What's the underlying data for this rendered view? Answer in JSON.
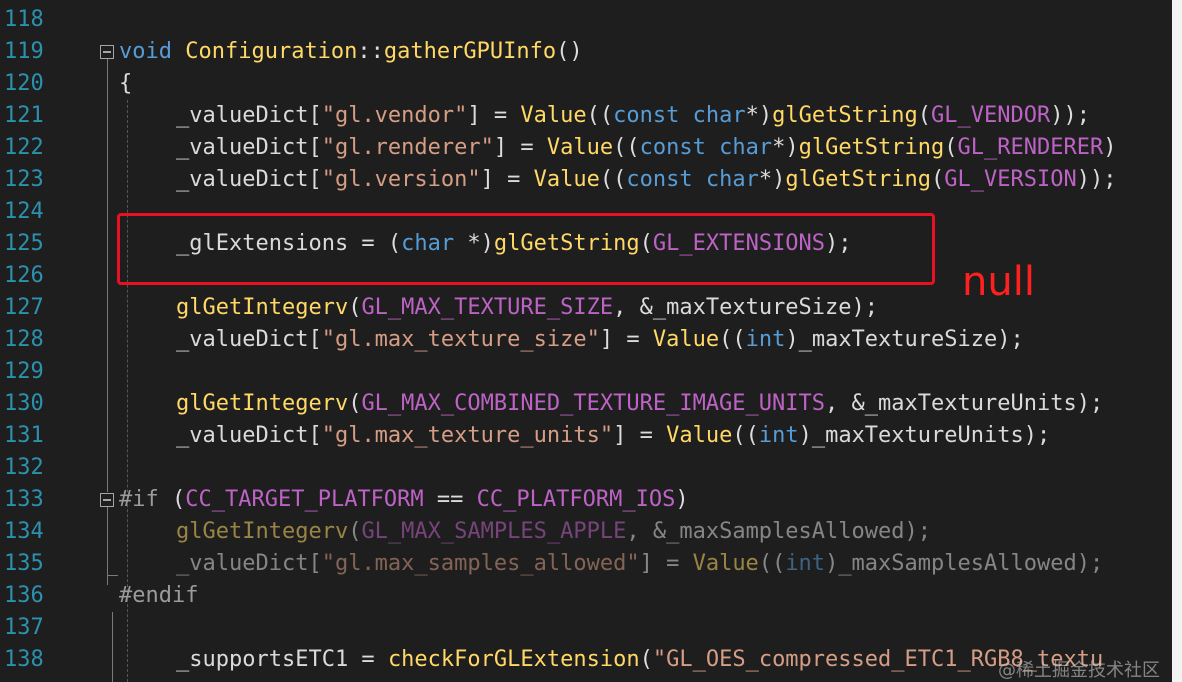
{
  "editor": {
    "lines": [
      {
        "n": "118",
        "code": ""
      },
      {
        "n": "119",
        "code": "void Configuration::gatherGPUInfo()"
      },
      {
        "n": "120",
        "code": "{"
      },
      {
        "n": "121",
        "code": "_valueDict[\"gl.vendor\"] = Value((const char*)glGetString(GL_VENDOR));"
      },
      {
        "n": "122",
        "code": "_valueDict[\"gl.renderer\"] = Value((const char*)glGetString(GL_RENDERER)"
      },
      {
        "n": "123",
        "code": "_valueDict[\"gl.version\"] = Value((const char*)glGetString(GL_VERSION));"
      },
      {
        "n": "124",
        "code": ""
      },
      {
        "n": "125",
        "code": "_glExtensions = (char *)glGetString(GL_EXTENSIONS);"
      },
      {
        "n": "126",
        "code": ""
      },
      {
        "n": "127",
        "code": "glGetIntegerv(GL_MAX_TEXTURE_SIZE, &_maxTextureSize);"
      },
      {
        "n": "128",
        "code": "_valueDict[\"gl.max_texture_size\"] = Value((int)_maxTextureSize);"
      },
      {
        "n": "129",
        "code": ""
      },
      {
        "n": "130",
        "code": "glGetIntegerv(GL_MAX_COMBINED_TEXTURE_IMAGE_UNITS, &_maxTextureUnits);"
      },
      {
        "n": "131",
        "code": "_valueDict[\"gl.max_texture_units\"] = Value((int)_maxTextureUnits);"
      },
      {
        "n": "132",
        "code": ""
      },
      {
        "n": "133",
        "code": "#if (CC_TARGET_PLATFORM == CC_PLATFORM_IOS)"
      },
      {
        "n": "134",
        "code": "glGetIntegerv(GL_MAX_SAMPLES_APPLE, &_maxSamplesAllowed);"
      },
      {
        "n": "135",
        "code": "_valueDict[\"gl.max_samples_allowed\"] = Value((int)_maxSamplesAllowed);"
      },
      {
        "n": "136",
        "code": "#endif"
      },
      {
        "n": "137",
        "code": ""
      },
      {
        "n": "138",
        "code": "_supportsETC1 = checkForGLExtension(\"GL_OES_compressed_ETC1_RGB8_textu"
      }
    ]
  },
  "annotation": {
    "text": "null"
  },
  "watermark": {
    "text": "@稀土掘金技术社区"
  },
  "colors": {
    "background": "#1e1e1e",
    "line_number": "#2b91af",
    "keyword": "#569cd6",
    "function": "#dcdcaa",
    "string": "#d69d85",
    "macro": "#bd63c5",
    "highlight_box": "#e81123",
    "annotation": "#ff2020"
  }
}
